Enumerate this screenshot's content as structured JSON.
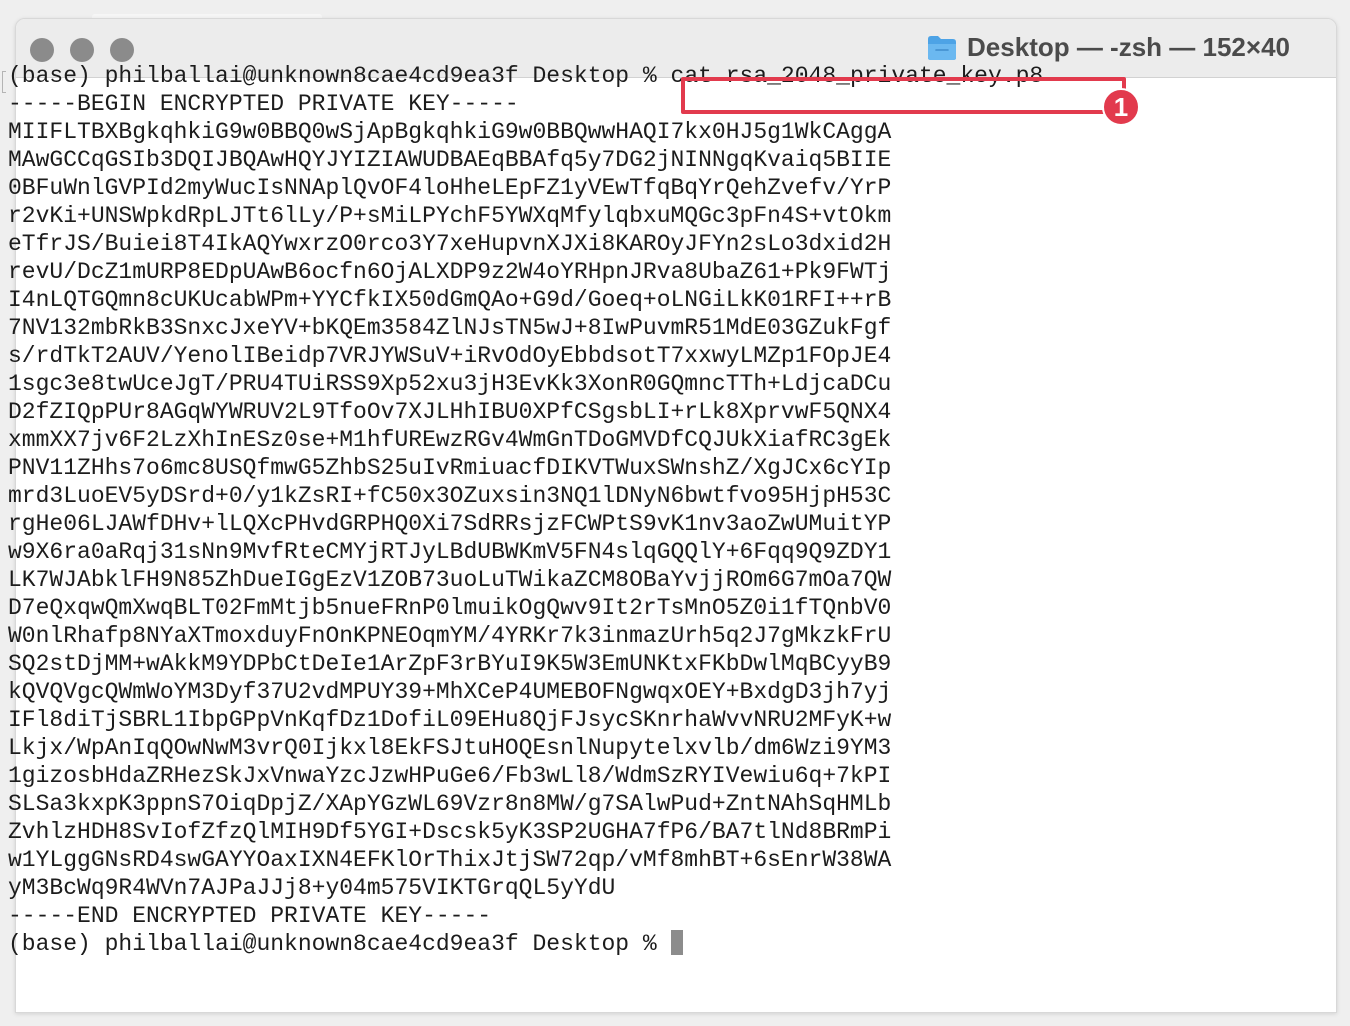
{
  "window": {
    "title": "Desktop — -zsh — 152×40",
    "icon": "folder-icon",
    "traffic_lights": [
      "close-button",
      "minimize-button",
      "zoom-button"
    ]
  },
  "terminal": {
    "prompt": "(base) philballai@unknown8cae4cd9ea3f Desktop % ",
    "command": "cat rsa_2048_private_key.p8",
    "key_begin": "-----BEGIN ENCRYPTED PRIVATE KEY-----",
    "key_lines": [
      "MIIFLTBXBgkqhkiG9w0BBQ0wSjApBgkqhkiG9w0BBQwwHAQI7kx0HJ5g1WkCAggA",
      "MAwGCCqGSIb3DQIJBQAwHQYJYIZIAWUDBAEqBBAfq5y7DG2jNINNgqKvaiq5BIIE",
      "0BFuWnlGVPId2myWucIsNNAplQvOF4loHheLEpFZ1yVEwTfqBqYrQehZvefv/YrP",
      "r2vKi+UNSWpkdRpLJTt6lLy/P+sMiLPYchF5YWXqMfylqbxuMQGc3pFn4S+vtOkm",
      "eTfrJS/Buiei8T4IkAQYwxrzO0rco3Y7xeHupvnXJXi8KAROyJFYn2sLo3dxid2H",
      "revU/DcZ1mURP8EDpUAwB6ocfn6OjALXDP9z2W4oYRHpnJRva8UbaZ61+Pk9FWTj",
      "I4nLQTGQmn8cUKUcabWPm+YYCfkIX50dGmQAo+G9d/Goeq+oLNGiLkK01RFI++rB",
      "7NV132mbRkB3SnxcJxeYV+bKQEm3584ZlNJsTN5wJ+8IwPuvmR51MdE03GZukFgf",
      "s/rdTkT2AUV/YenolIBeidp7VRJYWSuV+iRvOdOyEbbdsotT7xxwyLMZp1FOpJE4",
      "1sgc3e8twUceJgT/PRU4TUiRSS9Xp52xu3jH3EvKk3XonR0GQmncTTh+LdjcaDCu",
      "D2fZIQpPUr8AGqWYWRUV2L9TfoOv7XJLHhIBU0XPfCSgsbLI+rLk8XprvwF5QNX4",
      "xmmXX7jv6F2LzXhInESz0se+M1hfUREwzRGv4WmGnTDoGMVDfCQJUkXiafRC3gEk",
      "PNV11ZHhs7o6mc8USQfmwG5ZhbS25uIvRmiuacfDIKVTWuxSWnshZ/XgJCx6cYIp",
      "mrd3LuoEV5yDSrd+0/y1kZsRI+fC50x3OZuxsin3NQ1lDNyN6bwtfvo95HjpH53C",
      "rgHe06LJAWfDHv+lLQXcPHvdGRPHQ0Xi7SdRRsjzFCWPtS9vK1nv3aoZwUMuitYP",
      "w9X6ra0aRqj31sNn9MvfRteCMYjRTJyLBdUBWKmV5FN4slqGQQlY+6Fqq9Q9ZDY1",
      "LK7WJAbklFH9N85ZhDueIGgEzV1ZOB73uoLuTWikaZCM8OBaYvjjROm6G7mOa7QW",
      "D7eQxqwQmXwqBLT02FmMtjb5nueFRnP0lmuikOgQwv9It2rTsMnO5Z0i1fTQnbV0",
      "W0nlRhafp8NYaXTmoxduyFnOnKPNEOqmYM/4YRKr7k3inmazUrh5q2J7gMkzkFrU",
      "SQ2stDjMM+wAkkM9YDPbCtDeIe1ArZpF3rBYuI9K5W3EmUNKtxFKbDwlMqBCyyB9",
      "kQVQVgcQWmWoYM3Dyf37U2vdMPUY39+MhXCeP4UMEBOFNgwqxOEY+BxdgD3jh7yj",
      "IFl8diTjSBRL1IbpGPpVnKqfDz1DofiL09EHu8QjFJsycSKnrhaWvvNRU2MFyK+w",
      "Lkjx/WpAnIqQOwNwM3vrQ0Ijkxl8EkFSJtuHOQEsnlNupytelxvlb/dm6Wzi9YM3",
      "1gizosbHdaZRHezSkJxVnwaYzcJzwHPuGe6/Fb3wLl8/WdmSzRYIVewiu6q+7kPI",
      "SLSa3kxpK3ppnS7OiqDpjZ/XApYGzWL69Vzr8n8MW/g7SAlwPud+ZntNAhSqHMLb",
      "ZvhlzHDH8SvIofZfzQlMIH9Df5YGI+Dscsk5yK3SP2UGHA7fP6/BA7tlNd8BRmPi",
      "w1YLggGNsRD4swGAYYOaxIXN4EFKlOrThixJtjSW72qp/vMf8mhBT+6sEnrW38WA",
      "yM3BcWq9R4WVn7AJPaJJj8+y04m575VIKTGrqQL5yYdU"
    ],
    "key_end": "-----END ENCRYPTED PRIVATE KEY-----",
    "prompt2": "(base) philballai@unknown8cae4cd9ea3f Desktop % "
  },
  "annotation": {
    "badge_number": "1",
    "color": "#e23a4d"
  }
}
